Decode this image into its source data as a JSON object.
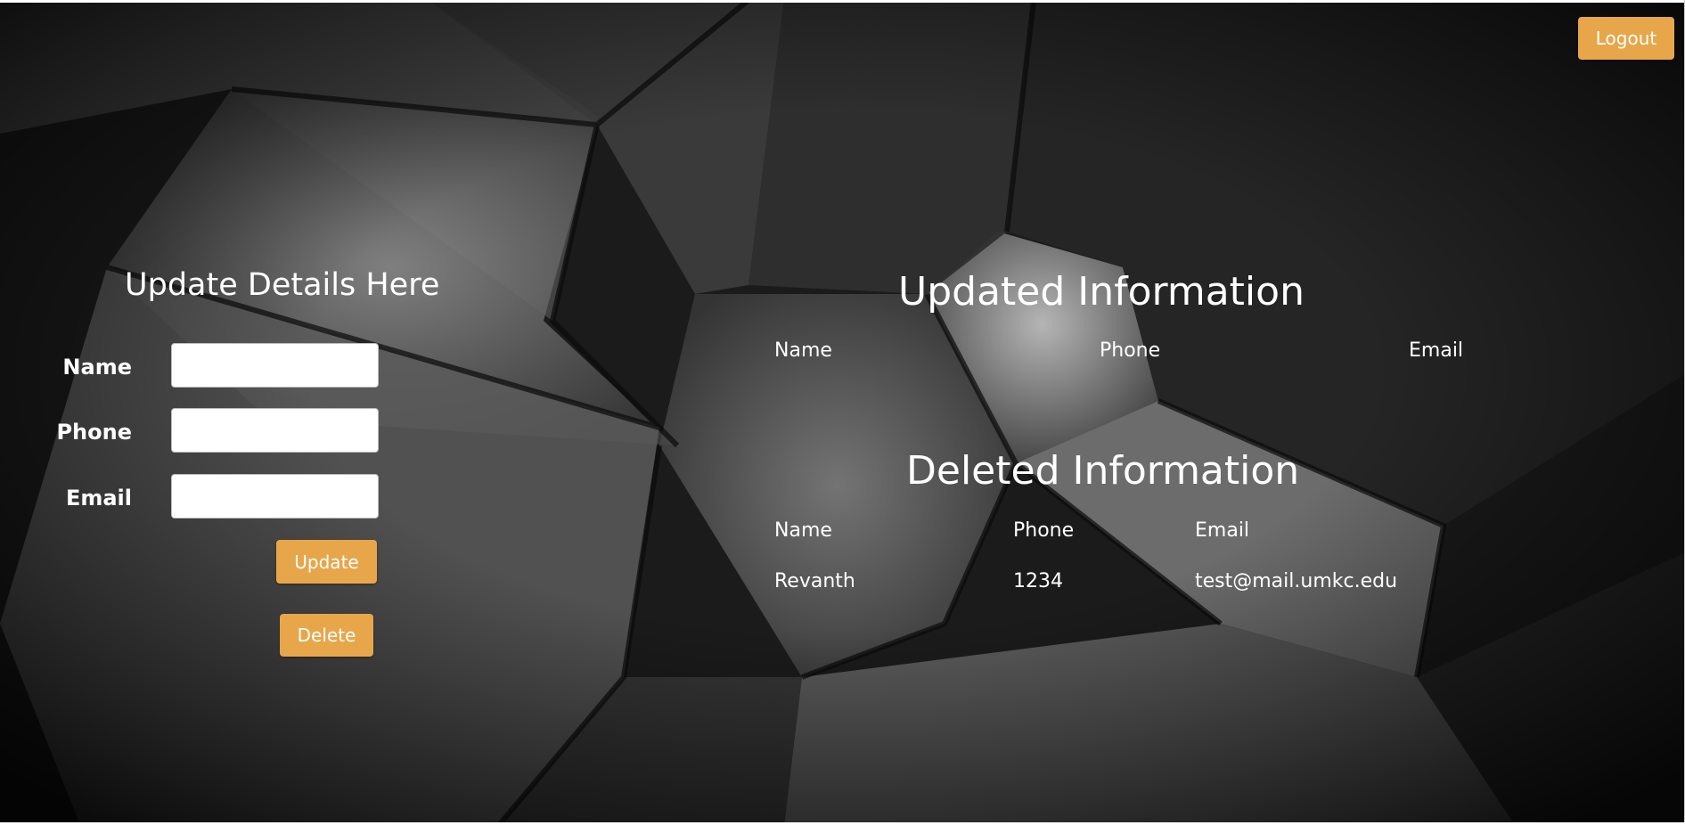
{
  "header": {
    "logout_label": "Logout"
  },
  "update_form": {
    "title": "Update Details Here",
    "fields": {
      "name_label": "Name",
      "phone_label": "Phone",
      "email_label": "Email",
      "name_value": "",
      "phone_value": "",
      "email_value": ""
    },
    "update_label": "Update",
    "delete_label": "Delete"
  },
  "updated_info": {
    "title": "Updated Information",
    "columns": [
      "Name",
      "Phone",
      "Email"
    ],
    "rows": []
  },
  "deleted_info": {
    "title": "Deleted Information",
    "columns": [
      "Name",
      "Phone",
      "Email"
    ],
    "rows": [
      [
        "Revanth",
        "1234",
        "test@mail.umkc.edu"
      ]
    ]
  },
  "colors": {
    "accent": "#e8a64a",
    "background": "#151515",
    "text": "#ffffff"
  }
}
